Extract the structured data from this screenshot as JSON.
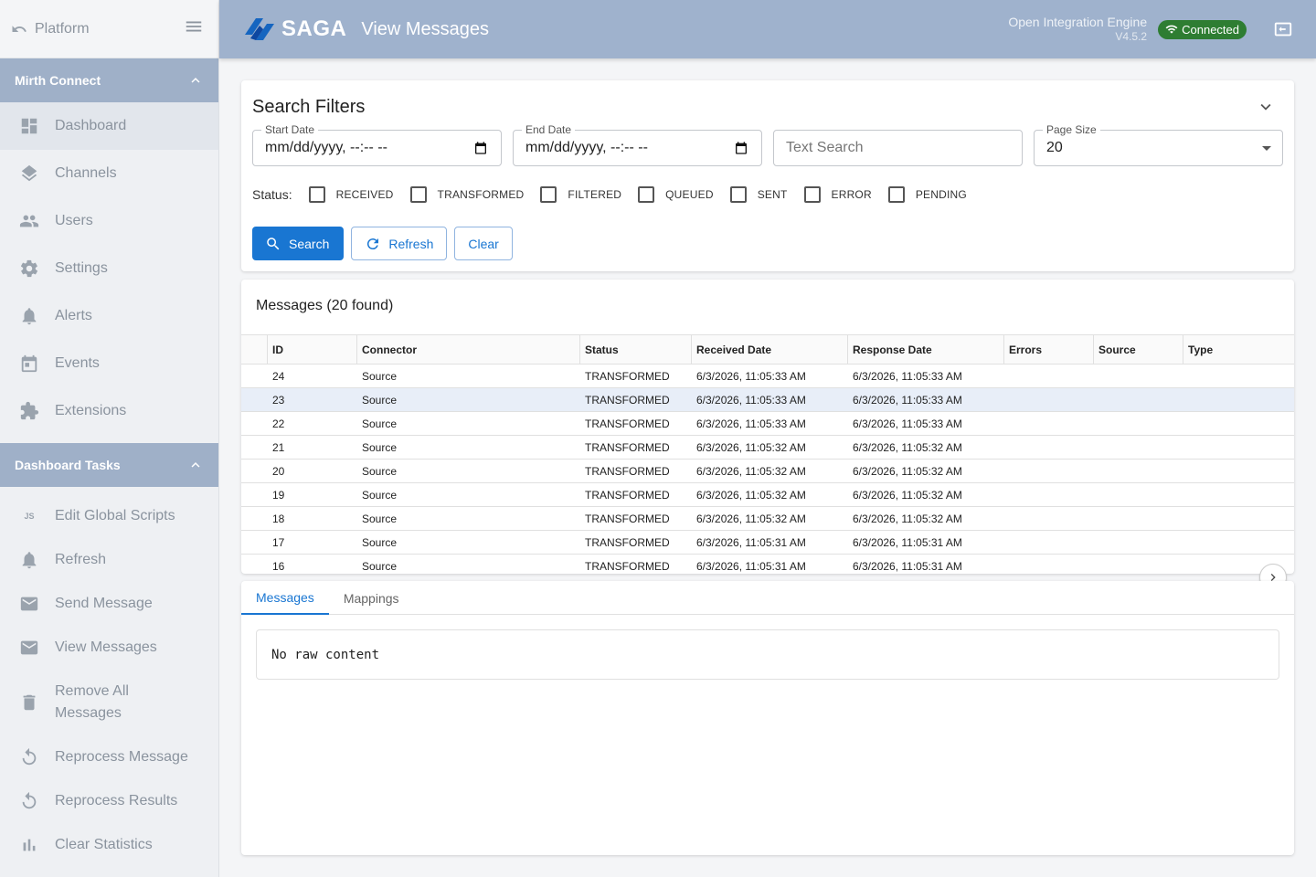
{
  "sidebar": {
    "back_label": "Platform",
    "section1": "Mirth Connect",
    "nav": [
      {
        "label": "Dashboard",
        "icon": "dashboard-icon"
      },
      {
        "label": "Channels",
        "icon": "layers-icon"
      },
      {
        "label": "Users",
        "icon": "people-icon"
      },
      {
        "label": "Settings",
        "icon": "gear-icon"
      },
      {
        "label": "Alerts",
        "icon": "bell-icon"
      },
      {
        "label": "Events",
        "icon": "calendar-icon"
      },
      {
        "label": "Extensions",
        "icon": "puzzle-icon"
      }
    ],
    "section2": "Dashboard Tasks",
    "tasks": [
      {
        "label": "Edit Global Scripts",
        "icon": "js-icon"
      },
      {
        "label": "Refresh",
        "icon": "bell-icon"
      },
      {
        "label": "Send Message",
        "icon": "mail-icon"
      },
      {
        "label": "View Messages",
        "icon": "mail-icon"
      },
      {
        "label": "Remove All Messages",
        "icon": "trash-icon"
      },
      {
        "label": "Reprocess Message",
        "icon": "reprocess-icon"
      },
      {
        "label": "Reprocess Results",
        "icon": "reprocess-icon"
      },
      {
        "label": "Clear Statistics",
        "icon": "bar-chart-icon"
      }
    ]
  },
  "header": {
    "logo_text": "SAGA",
    "title": "View Messages",
    "engine_name": "Open Integration Engine",
    "version": "V4.5.2",
    "connection": "Connected"
  },
  "filters": {
    "title": "Search Filters",
    "start_date_label": "Start Date",
    "start_date_value": "mm/dd/yyyy, --:-- --",
    "end_date_label": "End Date",
    "end_date_value": "mm/dd/yyyy, --:-- --",
    "text_search_placeholder": "Text Search",
    "page_size_label": "Page Size",
    "page_size_value": "20",
    "status_label": "Status:",
    "statuses": [
      "RECEIVED",
      "TRANSFORMED",
      "FILTERED",
      "QUEUED",
      "SENT",
      "ERROR",
      "PENDING"
    ],
    "search_label": "Search",
    "refresh_label": "Refresh",
    "clear_label": "Clear"
  },
  "messages": {
    "title": "Messages (20 found)",
    "columns": [
      "ID",
      "Connector",
      "Status",
      "Received Date",
      "Response Date",
      "Errors",
      "Source",
      "Type"
    ],
    "rows": [
      [
        "24",
        "Source",
        "TRANSFORMED",
        "6/3/2026, 11:05:33 AM",
        "6/3/2026, 11:05:33 AM",
        "",
        "",
        ""
      ],
      [
        "23",
        "Source",
        "TRANSFORMED",
        "6/3/2026, 11:05:33 AM",
        "6/3/2026, 11:05:33 AM",
        "",
        "",
        ""
      ],
      [
        "22",
        "Source",
        "TRANSFORMED",
        "6/3/2026, 11:05:33 AM",
        "6/3/2026, 11:05:33 AM",
        "",
        "",
        ""
      ],
      [
        "21",
        "Source",
        "TRANSFORMED",
        "6/3/2026, 11:05:32 AM",
        "6/3/2026, 11:05:32 AM",
        "",
        "",
        ""
      ],
      [
        "20",
        "Source",
        "TRANSFORMED",
        "6/3/2026, 11:05:32 AM",
        "6/3/2026, 11:05:32 AM",
        "",
        "",
        ""
      ],
      [
        "19",
        "Source",
        "TRANSFORMED",
        "6/3/2026, 11:05:32 AM",
        "6/3/2026, 11:05:32 AM",
        "",
        "",
        ""
      ],
      [
        "18",
        "Source",
        "TRANSFORMED",
        "6/3/2026, 11:05:32 AM",
        "6/3/2026, 11:05:32 AM",
        "",
        "",
        ""
      ],
      [
        "17",
        "Source",
        "TRANSFORMED",
        "6/3/2026, 11:05:31 AM",
        "6/3/2026, 11:05:31 AM",
        "",
        "",
        ""
      ],
      [
        "16",
        "Source",
        "TRANSFORMED",
        "6/3/2026, 11:05:31 AM",
        "6/3/2026, 11:05:31 AM",
        "",
        "",
        ""
      ]
    ],
    "selected_row_index": 1
  },
  "details": {
    "tabs": [
      "Messages",
      "Mappings"
    ],
    "raw_content": "No raw content"
  },
  "colors": {
    "header_bg": "#9fb2cd",
    "primary": "#1976d2",
    "connected": "#2e7d32"
  }
}
